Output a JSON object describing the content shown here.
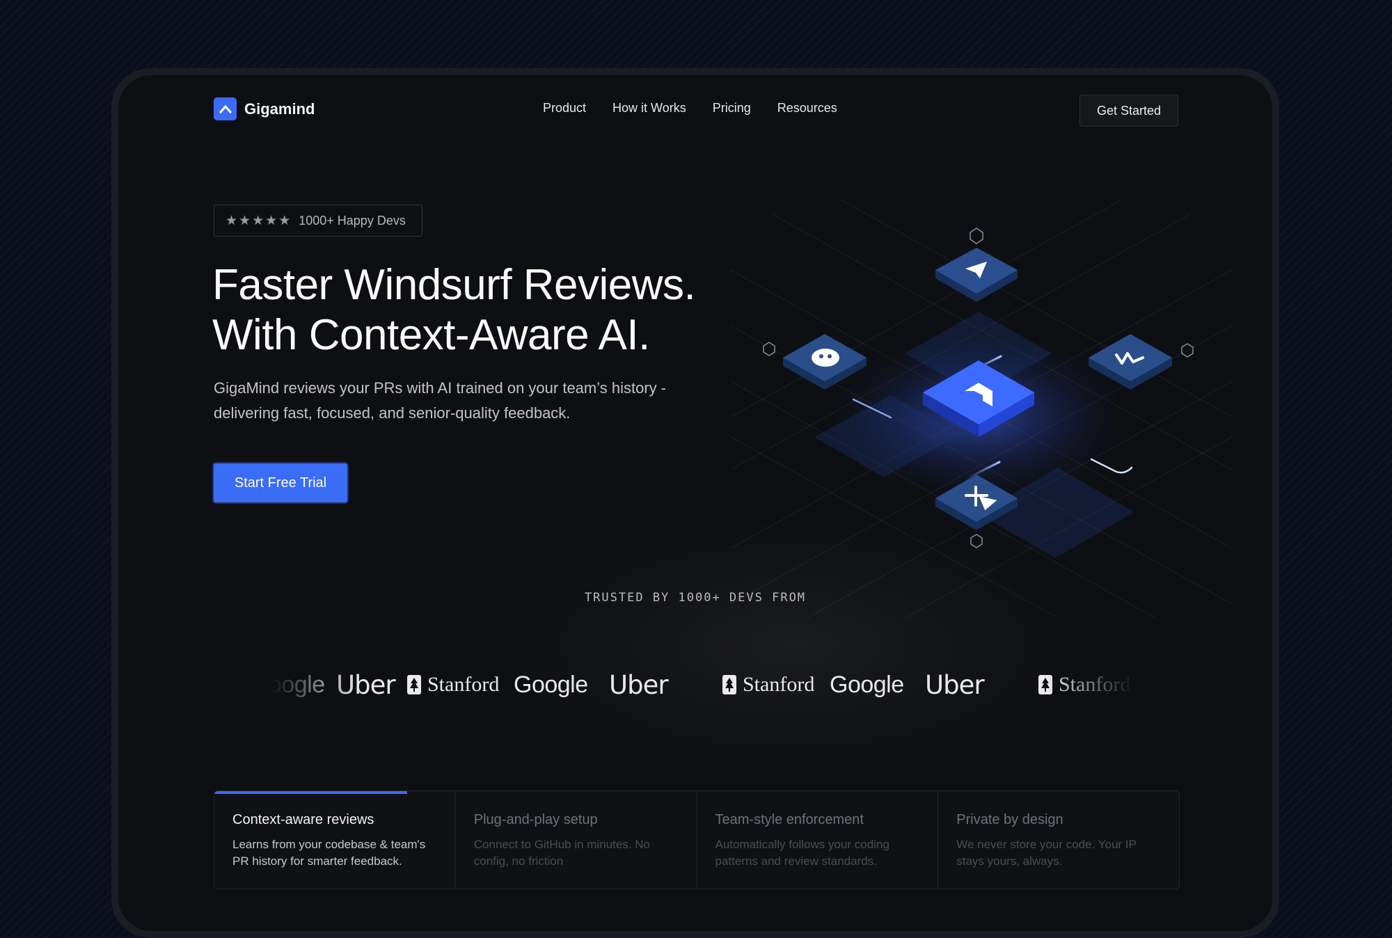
{
  "brand": {
    "name": "Gigamind",
    "icon": "chevron-up-icon",
    "color": "#3b6cf5"
  },
  "nav": [
    {
      "label": "Product"
    },
    {
      "label": "How it Works"
    },
    {
      "label": "Pricing"
    },
    {
      "label": "Resources"
    }
  ],
  "header": {
    "cta_label": "Get Started"
  },
  "hero": {
    "rating": {
      "stars": 5,
      "text": "1000+ Happy Devs"
    },
    "title_line1": "Faster Windsurf Reviews.",
    "title_line2": "With Context-Aware AI.",
    "subtitle": "GigaMind reviews your PRs with AI trained on your team’s history - delivering fast, focused, and senior-quality feedback.",
    "cta_label": "Start Free Trial"
  },
  "integrations": {
    "center": "gigamind-icon",
    "nodes": [
      "send-icon",
      "bug-icon",
      "windsurf-icon",
      "figma-icon"
    ]
  },
  "trusted": {
    "heading": "TRUSTED BY 1000+ DEVS FROM",
    "logos": [
      "Google",
      "Uber",
      "Stanford",
      "Google",
      "Uber",
      "Stanford",
      "Google",
      "Uber",
      "Stanford"
    ]
  },
  "features": [
    {
      "title": "Context-aware reviews",
      "desc": "Learns from your codebase & team's PR history for smarter feedback.",
      "active": true
    },
    {
      "title": "Plug-and-play setup",
      "desc": "Connect to GitHub in minutes. No config, no friction",
      "active": false
    },
    {
      "title": "Team-style enforcement",
      "desc": "Automatically follows your coding patterns and review standards.",
      "active": false
    },
    {
      "title": "Private by design",
      "desc": "We never store your code. Your IP stays yours, always.",
      "active": false
    }
  ],
  "colors": {
    "accent": "#3b6cf5",
    "background": "#0b0f1c",
    "panel": "#0e0f12"
  }
}
